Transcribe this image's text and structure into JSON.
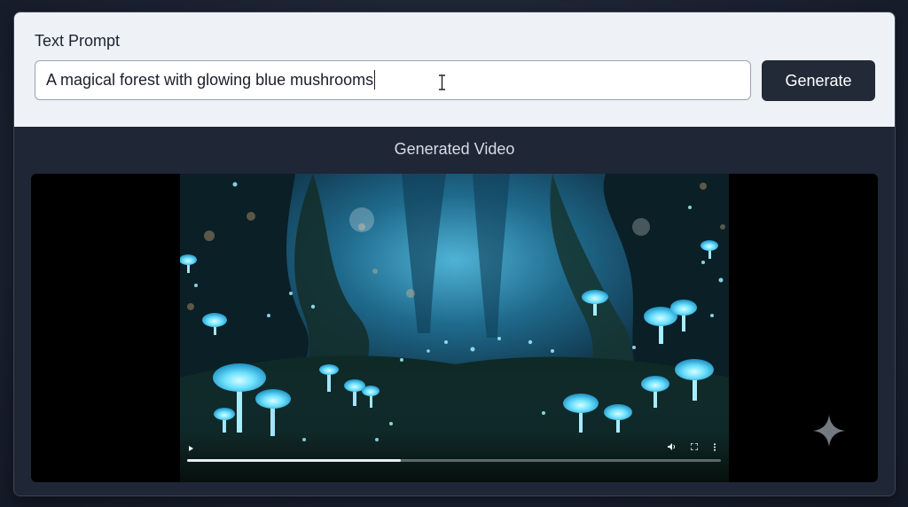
{
  "prompt": {
    "label": "Text Prompt",
    "value": "A magical forest with glowing blue mushrooms",
    "generate_label": "Generate"
  },
  "video": {
    "title": "Generated Video",
    "progress": 0.4,
    "controls": [
      "play-icon",
      "volume-icon",
      "fullscreen-icon",
      "more-icon"
    ]
  },
  "icons": {
    "watermark": "sparkle-icon",
    "cursor": "text-cursor-icon"
  },
  "colors": {
    "button_bg": "#222a38",
    "panel_bg": "#eef2f6",
    "video_bg": "#000000",
    "accent_glow": "#5fd6ff"
  }
}
